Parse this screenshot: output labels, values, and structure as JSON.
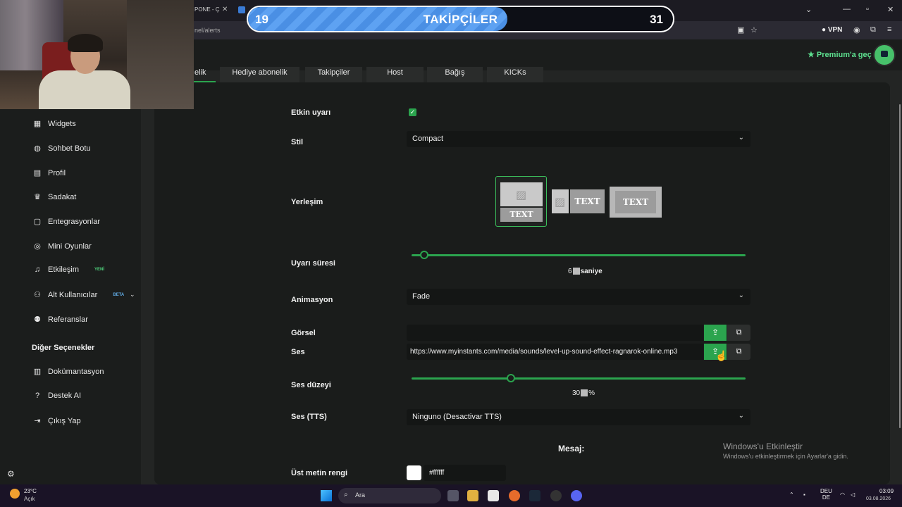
{
  "browser": {
    "tab_text": "PONE - Ç",
    "url_fragment": "nel/alerts",
    "vpn_label": "VPN"
  },
  "goal": {
    "current": "19",
    "title": "TAKİPÇİLER",
    "target": "31",
    "progress": 0.61
  },
  "header": {
    "premium_label": "Premium'a geç"
  },
  "tabs": [
    {
      "label": "elik"
    },
    {
      "label": "Hediye abonelik"
    },
    {
      "label": "Takipçiler"
    },
    {
      "label": "Host"
    },
    {
      "label": "Bağış"
    },
    {
      "label": "KICKs"
    }
  ],
  "sidebar": {
    "items": [
      {
        "label": "Widgets",
        "icon": "grid-icon"
      },
      {
        "label": "Sohbet Botu",
        "icon": "robot-icon"
      },
      {
        "label": "Profil",
        "icon": "id-card-icon"
      },
      {
        "label": "Sadakat",
        "icon": "trophy-icon"
      },
      {
        "label": "Entegrasyonlar",
        "icon": "plug-icon"
      },
      {
        "label": "Mini Oyunlar",
        "icon": "gamepad-icon"
      },
      {
        "label": "Etkileşim",
        "icon": "music-icon",
        "badge": "YENİ"
      },
      {
        "label": "Alt Kullanıcılar",
        "icon": "users-icon",
        "badge": "BETA"
      },
      {
        "label": "Referanslar",
        "icon": "user-group-icon"
      }
    ],
    "section_title": "Diğer Seçenekler",
    "other_items": [
      {
        "label": "Dokümantasyon",
        "icon": "document-icon"
      },
      {
        "label": "Destek AI",
        "icon": "question-icon"
      },
      {
        "label": "Çıkış Yap",
        "icon": "logout-icon"
      }
    ]
  },
  "form": {
    "enabled_label": "Etkin uyarı",
    "enabled_checked": true,
    "style_label": "Stil",
    "style_value": "Compact",
    "layout_label": "Yerleşim",
    "layout_option_text": "TEXT",
    "duration_label": "Uyarı süresi",
    "duration_value": "6",
    "duration_unit": "saniye",
    "duration_fraction": 0.04,
    "animation_label": "Animasyon",
    "animation_value": "Fade",
    "image_label": "Görsel",
    "image_value": "",
    "sound_label": "Ses",
    "sound_value": "https://www.myinstants.com/media/sounds/level-up-sound-effect-ragnarok-online.mp3",
    "volume_label": "Ses düzeyi",
    "volume_value": "30",
    "volume_unit": "%",
    "volume_fraction": 0.3,
    "tts_label": "Ses (TTS)",
    "tts_value": "Ninguno (Desactivar TTS)",
    "message_heading": "Mesaj:",
    "top_text_color_label": "Üst metin rengi",
    "top_text_color_value": "#ffffff"
  },
  "watermark": {
    "title": "Windows'u Etkinleştir",
    "subtitle": "Windows'u etkinleştirmek için Ayarlar'a gidin."
  },
  "taskbar": {
    "temperature": "23°C",
    "weather": "Açık",
    "search_placeholder": "Ara",
    "lang_top": "DEU",
    "lang_bottom": "DE",
    "time": "03:09",
    "date": "03.08.2026"
  },
  "colors": {
    "accent": "#2ba44e",
    "goal_fill": "#5ea2f2",
    "premium": "#5de08f"
  }
}
